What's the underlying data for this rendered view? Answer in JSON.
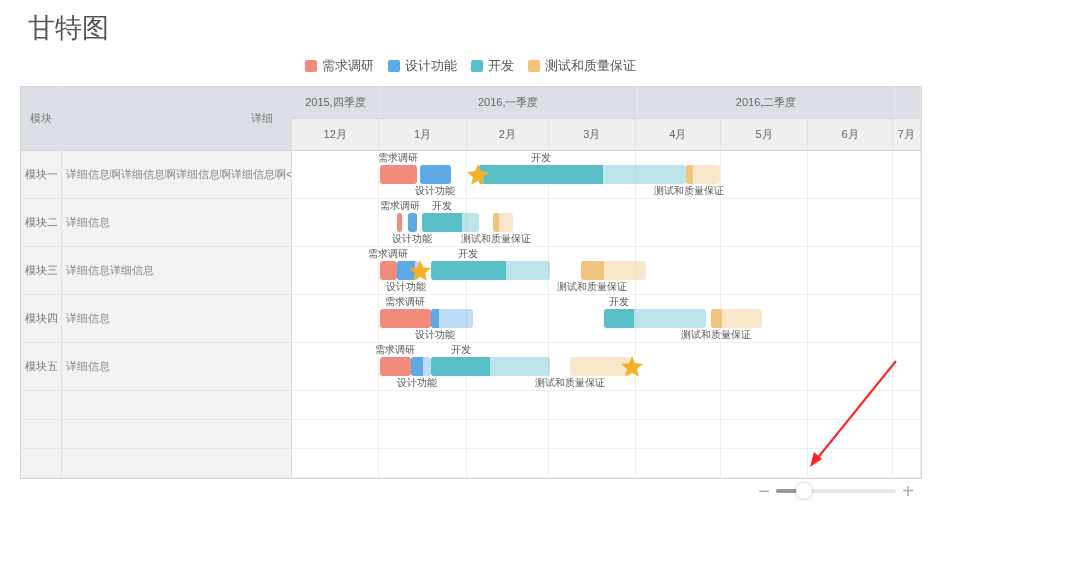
{
  "title": "甘特图",
  "legend": [
    {
      "kind": "research",
      "label": "需求调研",
      "color": "#f28b7c"
    },
    {
      "kind": "design",
      "label": "设计功能",
      "color": "#5ca9e6"
    },
    {
      "kind": "dev",
      "label": "开发",
      "color": "#58bec8"
    },
    {
      "kind": "test",
      "label": "测试和质量保证",
      "color": "#f0c47c"
    }
  ],
  "table": {
    "columns": [
      "模块",
      "详细"
    ],
    "quarters": [
      "2015,四季度",
      "2016,一季度",
      "2016,二季度"
    ],
    "months": [
      "12月",
      "1月",
      "2月",
      "3月",
      "4月",
      "5月",
      "6月",
      "7月"
    ],
    "rows": [
      {
        "module": "模块一",
        "detail": "详细信息啊详细信息啊详细信息啊详细信息啊<",
        "tasks": [
          {
            "kind": "research",
            "label": "需求调研",
            "level": 1
          },
          {
            "kind": "design",
            "label": "设计功能",
            "level": 1
          },
          {
            "kind": "dev",
            "label": "开发",
            "level": 0.6
          },
          {
            "kind": "test",
            "label": "测试和质量保证",
            "level": 0.2
          }
        ]
      },
      {
        "module": "模块二",
        "detail": "详细信息",
        "tasks": [
          {
            "kind": "research",
            "label": "需求调研",
            "level": 1
          },
          {
            "kind": "design",
            "label": "设计功能",
            "level": 1
          },
          {
            "kind": "dev",
            "label": "开发",
            "level": 0.7
          },
          {
            "kind": "test",
            "label": "测试和质量保证",
            "level": 0.3
          }
        ]
      },
      {
        "module": "模块三",
        "detail": "详细信息详细信息",
        "tasks": [
          {
            "kind": "research",
            "label": "需求调研",
            "level": 1
          },
          {
            "kind": "design",
            "label": "设计功能",
            "level": 0.8
          },
          {
            "kind": "dev",
            "label": "开发",
            "level": 0.63
          },
          {
            "kind": "test",
            "label": "测试和质量保证",
            "level": 0.35
          }
        ]
      },
      {
        "module": "模块四",
        "detail": "详细信息",
        "tasks": [
          {
            "kind": "research",
            "label": "需求调研",
            "level": 1
          },
          {
            "kind": "design",
            "label": "设计功能",
            "level": 0.2
          },
          {
            "kind": "dev",
            "label": "开发",
            "level": 0.3
          },
          {
            "kind": "test",
            "label": "测试和质量保证",
            "level": 0.2
          }
        ]
      },
      {
        "module": "模块五",
        "detail": "详细信息",
        "tasks": [
          {
            "kind": "research",
            "label": "需求调研",
            "level": 1
          },
          {
            "kind": "design",
            "label": "设计功能",
            "level": 0.6
          },
          {
            "kind": "dev",
            "label": "开发",
            "level": 0.5
          },
          {
            "kind": "test",
            "label": "测试和质量保证",
            "level": 0
          }
        ]
      }
    ]
  },
  "zoom": {
    "minus": "−",
    "plus": "+",
    "level": 0.23
  }
}
